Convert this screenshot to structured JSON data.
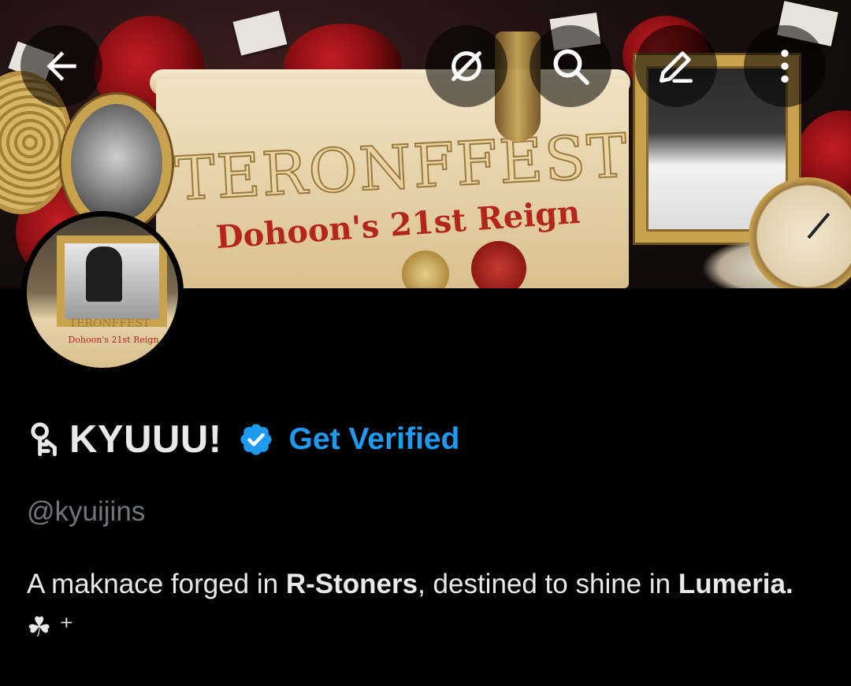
{
  "header": {
    "banner_title": "TERONFFEST",
    "banner_subtitle": "Dohoon's 21st Reign",
    "nav": {
      "back_icon": "arrow-left-icon",
      "hide_icon": "eye-off-icon",
      "search_icon": "search-icon",
      "edit_icon": "pencil-icon",
      "more_icon": "more-vertical-icon"
    }
  },
  "avatar": {
    "mini_title": "TERONFFEST",
    "mini_subtitle": "Dohoon's 21st Reign"
  },
  "profile": {
    "name_emoji": "key-icon",
    "display_name": "KYUUU!",
    "verified_icon": "verified-badge-icon",
    "get_verified_label": "Get Verified",
    "handle": "@kyuijins",
    "bio": {
      "part1": "A maknace forged in ",
      "bold1": "R-Stoners",
      "part2": ", destined to shine in ",
      "bold2": "Lumeria.",
      "symbols": " ☘︎ ⁺"
    }
  },
  "colors": {
    "background": "#000000",
    "text_primary": "#e7e9ea",
    "text_secondary": "#71767b",
    "accent": "#1d9bf0"
  }
}
